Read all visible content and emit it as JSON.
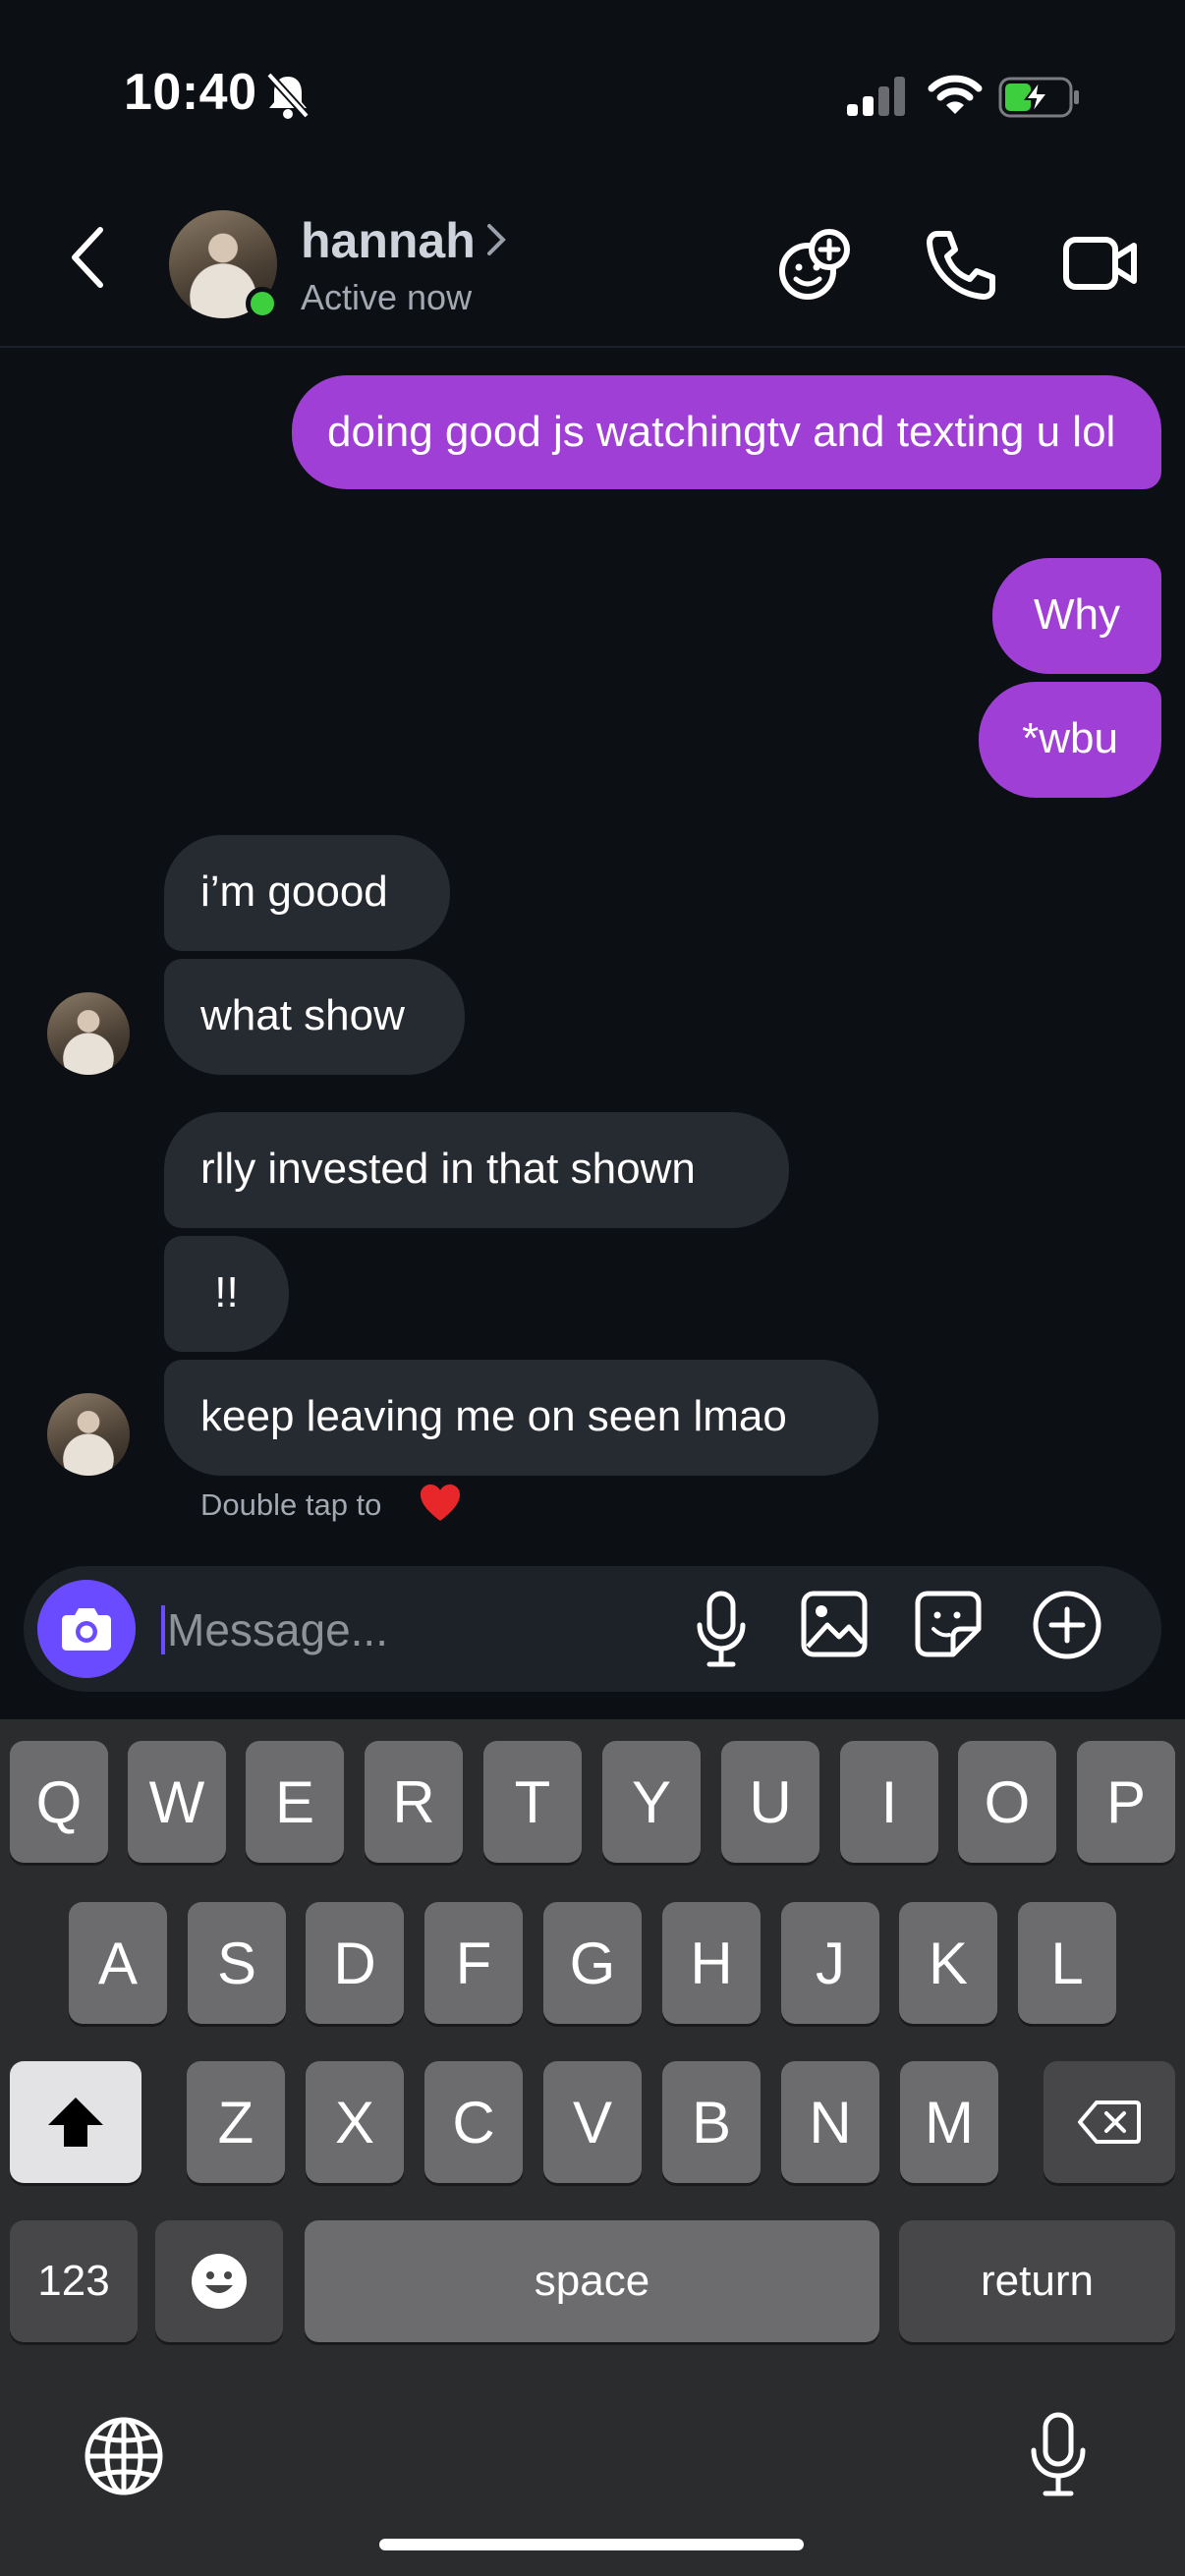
{
  "status_bar": {
    "time": "10:40",
    "silent": true,
    "signal_bars": 2,
    "charging": true
  },
  "header": {
    "contact_name": "hannah",
    "status": "Active now",
    "online": true
  },
  "messages": [
    {
      "from": "me",
      "text": "doing good js watchingtv and texting u lol"
    },
    {
      "from": "me",
      "text": "Why"
    },
    {
      "from": "me",
      "text": "*wbu"
    },
    {
      "from": "them",
      "text": "i’m goood"
    },
    {
      "from": "them",
      "text": "what show"
    },
    {
      "from": "them",
      "text": "rlly invested in that shown"
    },
    {
      "from": "them",
      "text": "!!"
    },
    {
      "from": "them",
      "text": "keep leaving me on seen lmao"
    }
  ],
  "reaction_hint": {
    "text": "Double tap to",
    "emoji": "heart"
  },
  "composer": {
    "placeholder": "Message..."
  },
  "keyboard": {
    "row1": [
      "Q",
      "W",
      "E",
      "R",
      "T",
      "Y",
      "U",
      "I",
      "O",
      "P"
    ],
    "row2": [
      "A",
      "S",
      "D",
      "F",
      "G",
      "H",
      "J",
      "K",
      "L"
    ],
    "row3": [
      "Z",
      "X",
      "C",
      "V",
      "B",
      "N",
      "M"
    ],
    "numbers_label": "123",
    "space_label": "space",
    "return_label": "return"
  },
  "colors": {
    "sent_bubble": "#a03fd6",
    "received_bubble": "#262a31",
    "background": "#0c0f14",
    "accent": "#6a4bff",
    "online": "#3ecf3e"
  }
}
